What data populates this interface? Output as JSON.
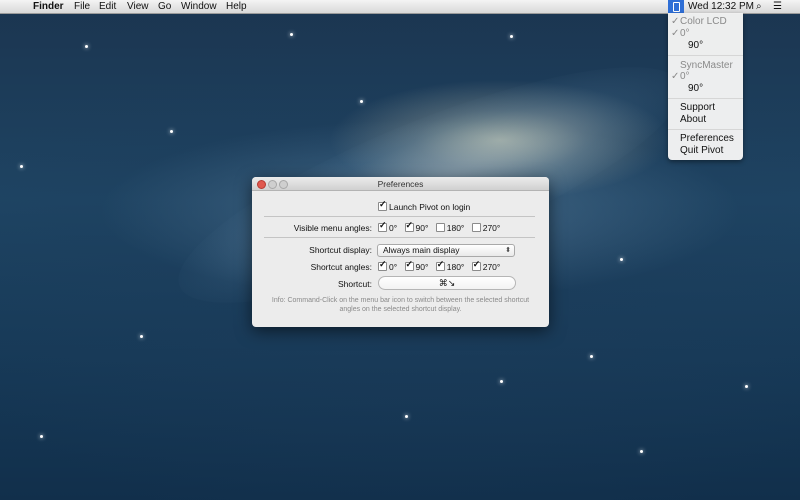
{
  "menubar": {
    "apple": "",
    "app_name": "Finder",
    "menus": [
      "File",
      "Edit",
      "View",
      "Go",
      "Window",
      "Help"
    ],
    "clock": "Wed 12:32 PM",
    "search_glyph": "⌕",
    "list_glyph": "☰"
  },
  "pivot_menu": {
    "display1": "Color LCD",
    "display1_angles": [
      {
        "label": "0°",
        "checked": true
      },
      {
        "label": "90°",
        "checked": false
      }
    ],
    "display2": "SyncMaster",
    "display2_angles": [
      {
        "label": "0°",
        "checked": true
      },
      {
        "label": "90°",
        "checked": false
      }
    ],
    "support": "Support",
    "about": "About",
    "preferences": "Preferences",
    "quit": "Quit Pivot",
    "check_glyph": "✓"
  },
  "prefs": {
    "title": "Preferences",
    "launch_label": "Launch Pivot on login",
    "visible_angles_label": "Visible menu angles:",
    "visible_angles": [
      {
        "label": "0°",
        "checked": true
      },
      {
        "label": "90°",
        "checked": true
      },
      {
        "label": "180°",
        "checked": false
      },
      {
        "label": "270°",
        "checked": false
      }
    ],
    "shortcut_display_label": "Shortcut display:",
    "shortcut_display_value": "Always main display",
    "select_arrows": "⬍",
    "shortcut_angles_label": "Shortcut angles:",
    "shortcut_angles": [
      {
        "label": "0°",
        "checked": true
      },
      {
        "label": "90°",
        "checked": true
      },
      {
        "label": "180°",
        "checked": true
      },
      {
        "label": "270°",
        "checked": true
      }
    ],
    "shortcut_label": "Shortcut:",
    "shortcut_value": "⌘↘",
    "info": "Info: Command-Click on the menu bar icon to switch between the selected shortcut angles on the selected shortcut display."
  }
}
